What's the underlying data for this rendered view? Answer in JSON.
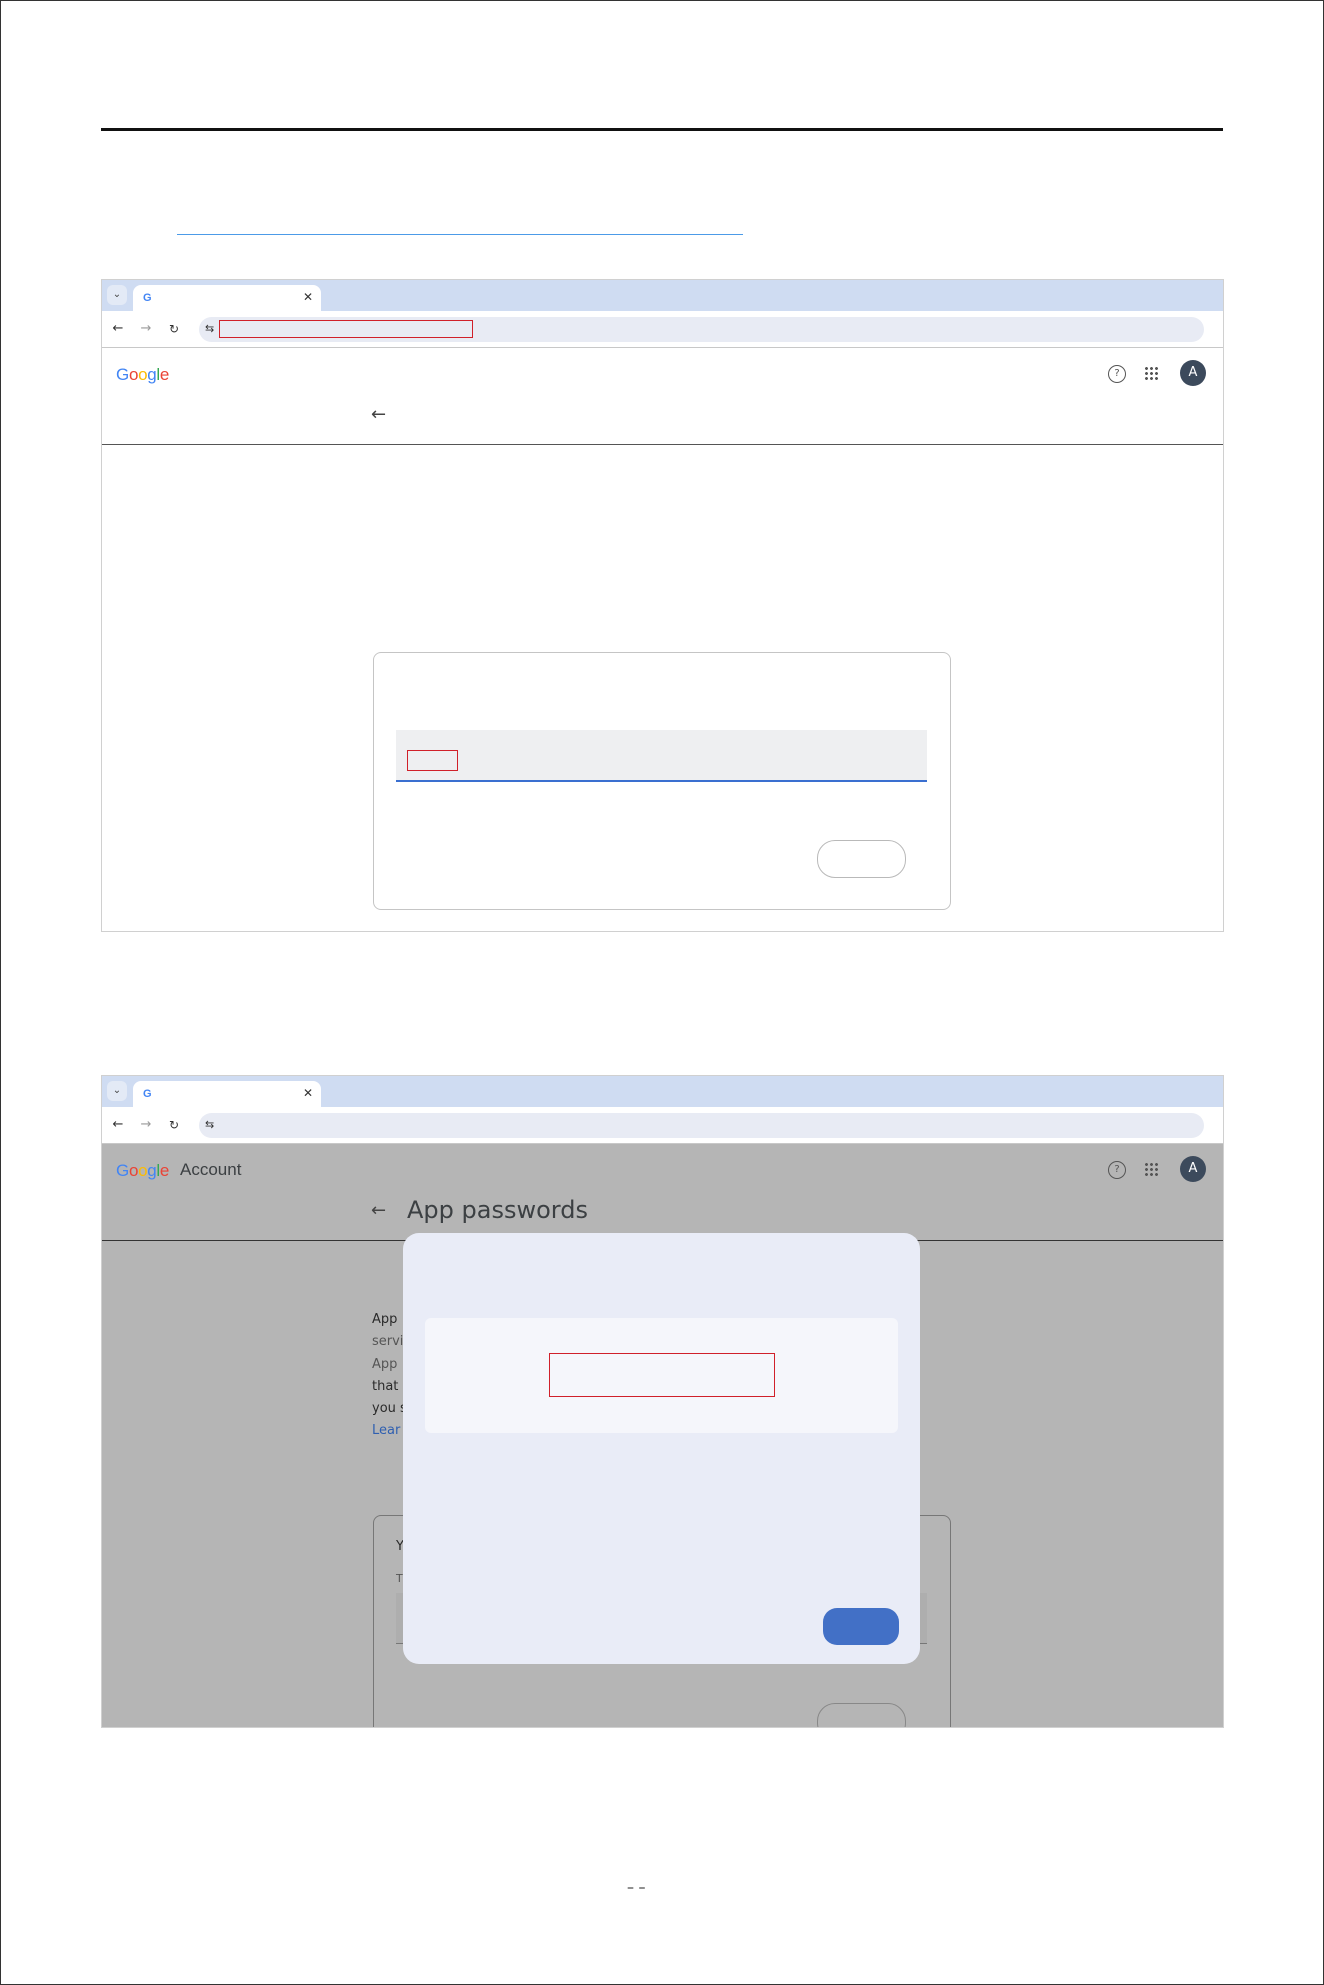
{
  "doc": {
    "page_number": "– –",
    "link_text": ""
  },
  "shot1": {
    "tab_title": "",
    "url": "",
    "logo": {
      "letters": [
        "G",
        "o",
        "o",
        "g",
        "l",
        "e"
      ]
    },
    "account_label": "",
    "page_heading": "",
    "card": {
      "title": "",
      "field_label": "",
      "field_value": "",
      "button_label": ""
    },
    "avatar_letter": "A"
  },
  "shot2": {
    "tab_title": "",
    "url": "",
    "account_label": "Account",
    "page_heading": "App passwords",
    "intro_lines": [
      "App",
      "servi",
      "App",
      "that",
      "you s",
      "Lear"
    ],
    "card": {
      "title": "Y",
      "subtitle": "T"
    },
    "dialog": {
      "title": "",
      "password": "",
      "note": "",
      "done_label": ""
    },
    "avatar_letter": "A"
  },
  "icons": {
    "tab_dropdown": "chevron-down-icon",
    "favicon": "google-g-icon",
    "close": "close-icon",
    "back": "arrow-left-icon",
    "forward": "arrow-right-icon",
    "reload": "reload-icon",
    "site_settings": "tune-icon",
    "help": "help-circle-icon",
    "apps": "apps-grid-icon"
  },
  "colors": {
    "accent_blue": "#3a6fd0",
    "button_blue": "#4270c6",
    "highlight_red": "#d0202a",
    "tabstrip": "#cfdcf2",
    "dim_overlay": "#b5b5b5"
  }
}
